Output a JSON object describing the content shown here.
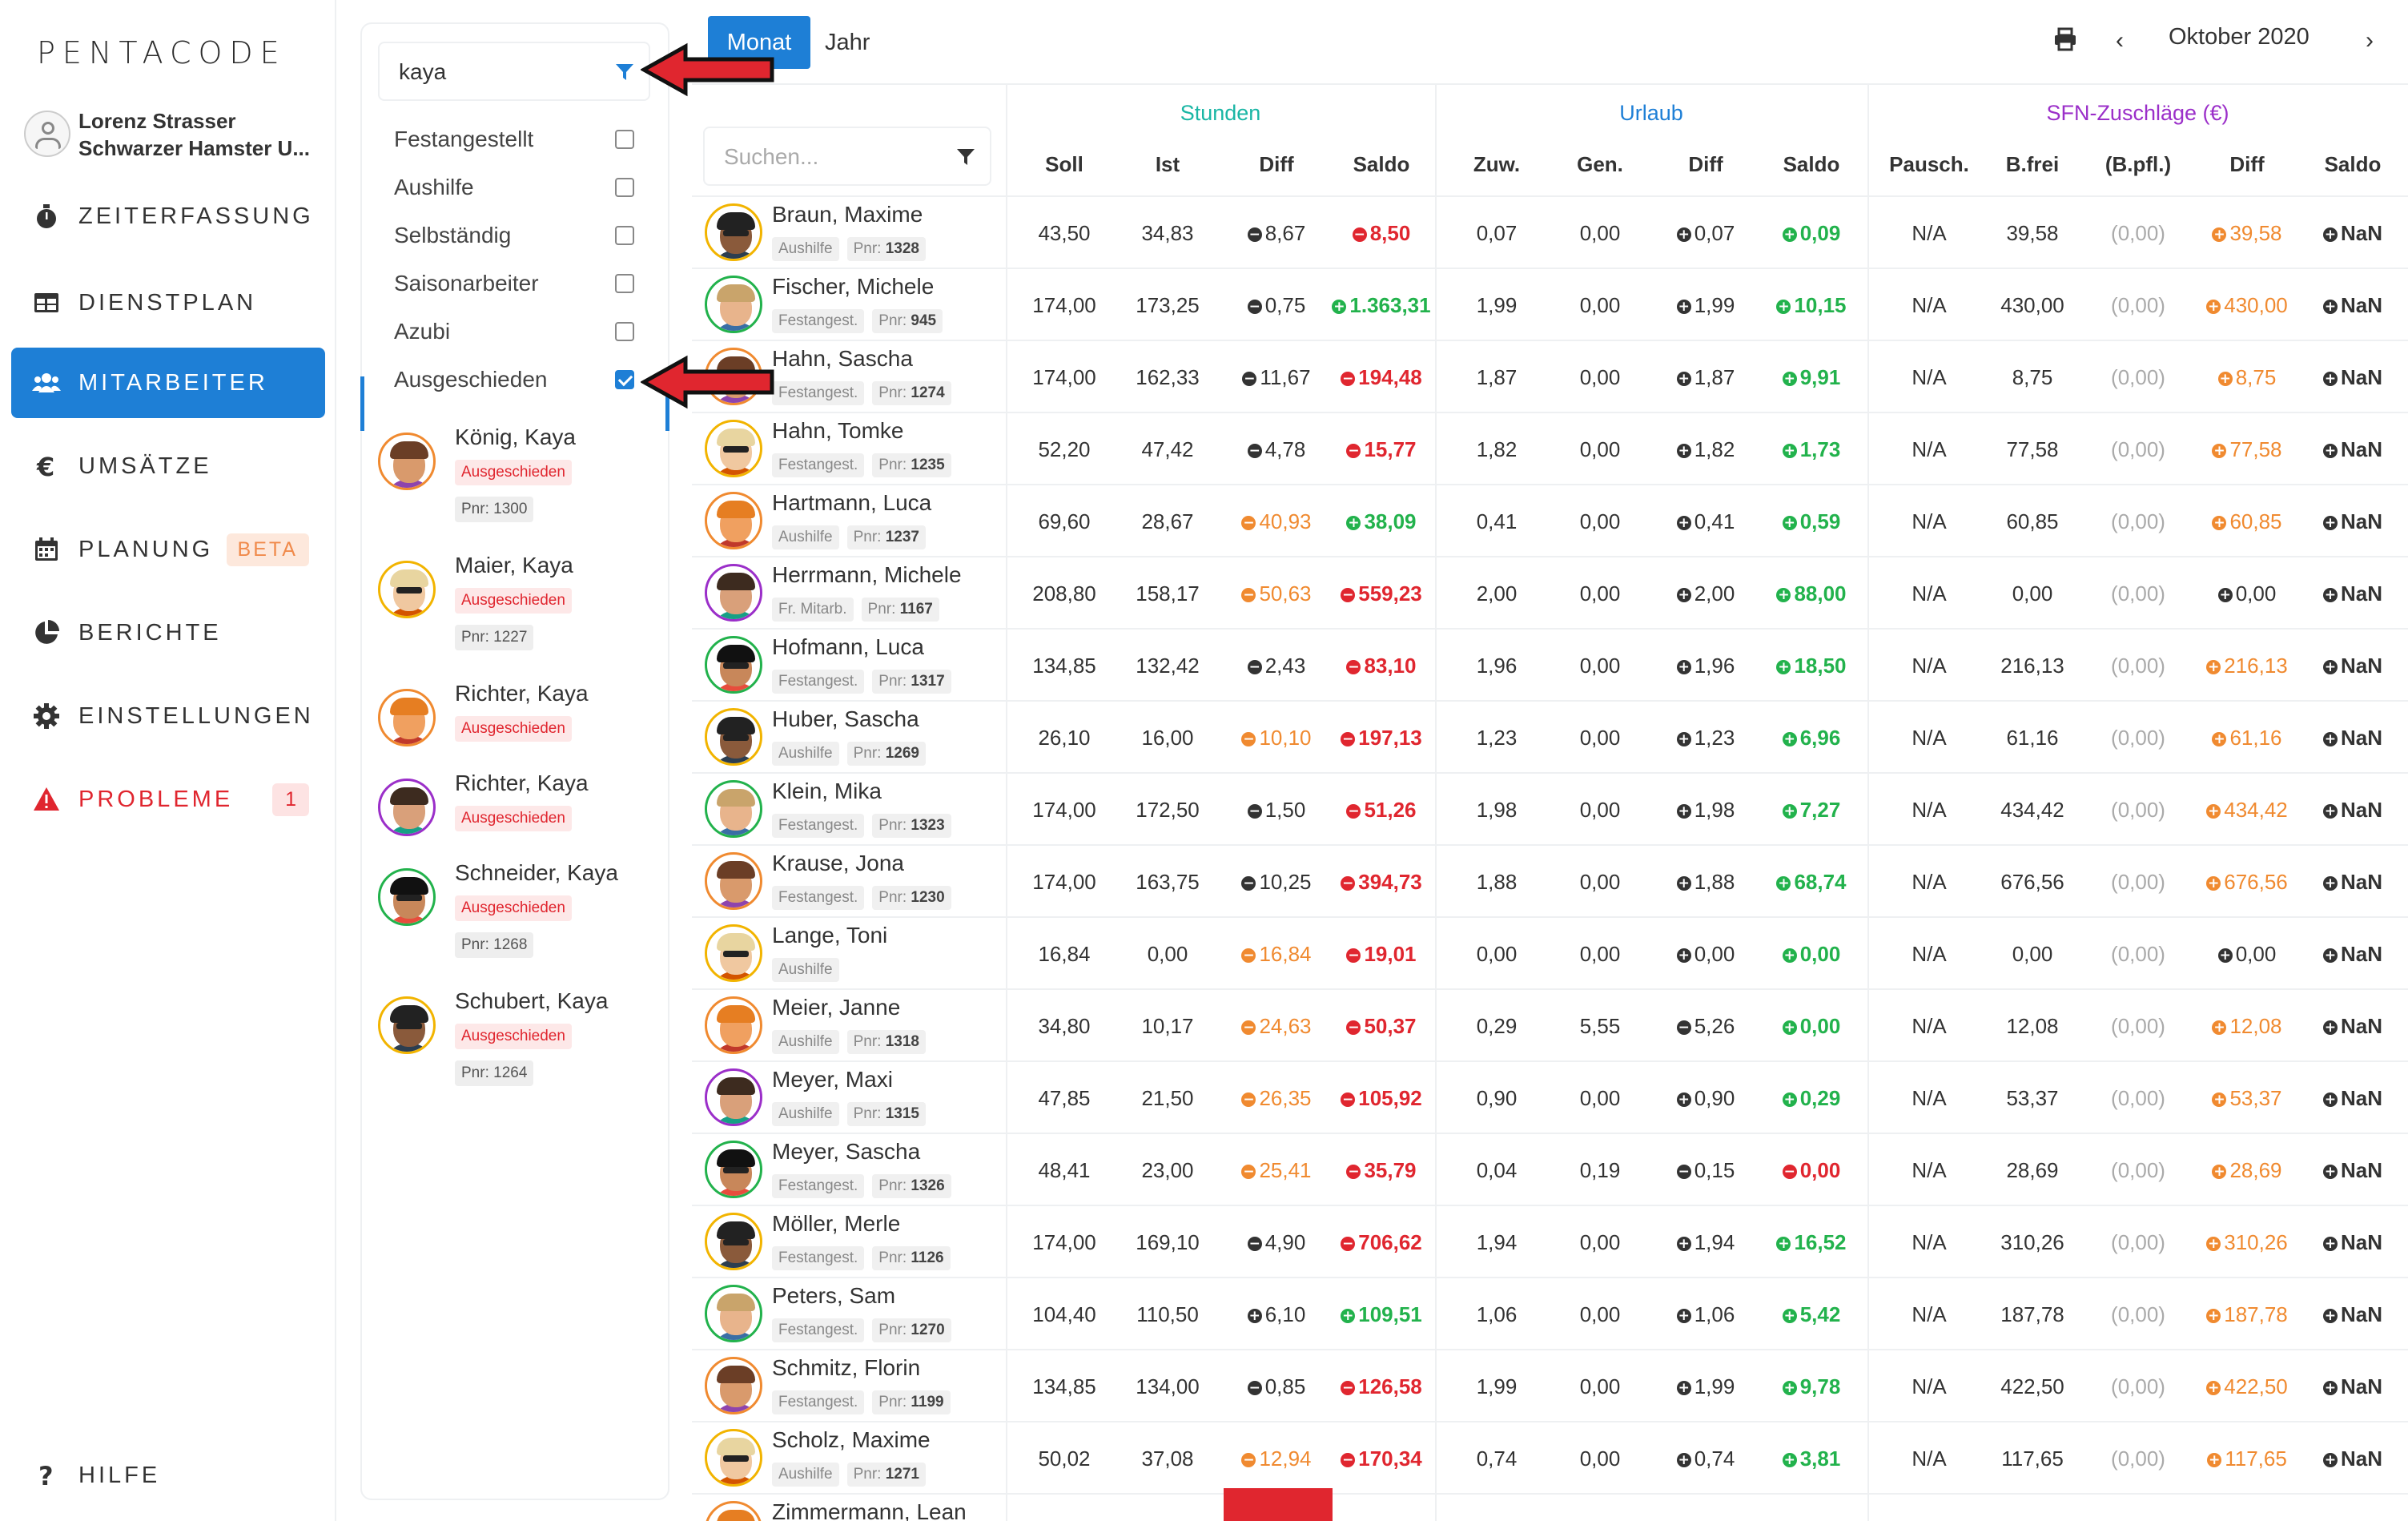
{
  "app": {
    "logo": "PENTACODE",
    "user_name": "Lorenz Strasser",
    "company": "Schwarzer Hamster U..."
  },
  "nav": [
    {
      "label": "ZEITERFASSUNG",
      "icon": "stopwatch-icon"
    },
    {
      "label": "DIENSTPLAN",
      "icon": "table-icon"
    },
    {
      "label": "MITARBEITER",
      "icon": "users-icon",
      "active": true
    },
    {
      "label": "UMSÄTZE",
      "icon": "euro-icon"
    },
    {
      "label": "PLANUNG",
      "icon": "calendar-icon",
      "badge": "BETA"
    },
    {
      "label": "BERICHTE",
      "icon": "pie-chart-icon"
    },
    {
      "label": "EINSTELLUNGEN",
      "icon": "gear-icon"
    },
    {
      "label": "PROBLEME",
      "icon": "warning-icon",
      "badge": "1"
    }
  ],
  "help": {
    "label": "HILFE",
    "icon": "question-icon"
  },
  "filter": {
    "search_value": "kaya",
    "options": [
      {
        "label": "Festangestellt",
        "checked": false
      },
      {
        "label": "Aushilfe",
        "checked": false
      },
      {
        "label": "Selbständig",
        "checked": false
      },
      {
        "label": "Saisonarbeiter",
        "checked": false
      },
      {
        "label": "Azubi",
        "checked": false
      },
      {
        "label": "Ausgeschieden",
        "checked": true
      }
    ],
    "results": [
      {
        "name": "König, Kaya",
        "status": "Ausgeschieden",
        "pnr": "Pnr: 1300"
      },
      {
        "name": "Maier, Kaya",
        "status": "Ausgeschieden",
        "pnr": "Pnr: 1227"
      },
      {
        "name": "Richter, Kaya",
        "status": "Ausgeschieden",
        "pnr": ""
      },
      {
        "name": "Richter, Kaya",
        "status": "Ausgeschieden",
        "pnr": ""
      },
      {
        "name": "Schneider, Kaya",
        "status": "Ausgeschieden",
        "pnr": "Pnr: 1268"
      },
      {
        "name": "Schubert, Kaya",
        "status": "Ausgeschieden",
        "pnr": "Pnr: 1264"
      }
    ]
  },
  "toolbar": {
    "tab_month": "Monat",
    "tab_year": "Jahr",
    "month_label": "Oktober 2020",
    "chev_left": "‹",
    "chev_right": "›"
  },
  "table": {
    "search_placeholder": "Suchen...",
    "groups": [
      {
        "label": "Stunden",
        "color": "#1ab6a5"
      },
      {
        "label": "Urlaub",
        "color": "#1e7fd6"
      },
      {
        "label": "SFN-Zuschläge (€)",
        "color": "#9b2fc9"
      }
    ],
    "columns": [
      "Soll",
      "Ist",
      "Diff",
      "Saldo",
      "Zuw.",
      "Gen.",
      "Diff",
      "Saldo",
      "Pausch.",
      "B.frei",
      "(B.pfl.)",
      "Diff",
      "Saldo"
    ],
    "rows": [
      {
        "name": "Braun, Maxime",
        "type": "Aushilfe",
        "pnr": "1328",
        "cells": [
          "43,50",
          "34,83",
          [
            "m",
            "8,67",
            "dark"
          ],
          [
            "m",
            "8,50",
            "red"
          ],
          "0,07",
          "0,00",
          [
            "p",
            "0,07",
            "dark"
          ],
          [
            "p",
            "0,09",
            "green"
          ],
          "N/A",
          "39,58",
          "(0,00)",
          [
            "p",
            "39,58",
            "orange"
          ],
          [
            "p",
            "NaN",
            "dark"
          ]
        ]
      },
      {
        "name": "Fischer, Michele",
        "type": "Festangest.",
        "pnr": "945",
        "cells": [
          "174,00",
          "173,25",
          [
            "m",
            "0,75",
            "dark"
          ],
          [
            "p",
            "1.363,31",
            "green"
          ],
          "1,99",
          "0,00",
          [
            "p",
            "1,99",
            "dark"
          ],
          [
            "p",
            "10,15",
            "green"
          ],
          "N/A",
          "430,00",
          "(0,00)",
          [
            "p",
            "430,00",
            "orange"
          ],
          [
            "p",
            "NaN",
            "dark"
          ]
        ]
      },
      {
        "name": "Hahn, Sascha",
        "type": "Festangest.",
        "pnr": "1274",
        "cells": [
          "174,00",
          "162,33",
          [
            "m",
            "11,67",
            "dark"
          ],
          [
            "m",
            "194,48",
            "red"
          ],
          "1,87",
          "0,00",
          [
            "p",
            "1,87",
            "dark"
          ],
          [
            "p",
            "9,91",
            "green"
          ],
          "N/A",
          "8,75",
          "(0,00)",
          [
            "p",
            "8,75",
            "orange"
          ],
          [
            "p",
            "NaN",
            "dark"
          ]
        ]
      },
      {
        "name": "Hahn, Tomke",
        "type": "Festangest.",
        "pnr": "1235",
        "cells": [
          "52,20",
          "47,42",
          [
            "m",
            "4,78",
            "dark"
          ],
          [
            "m",
            "15,77",
            "red"
          ],
          "1,82",
          "0,00",
          [
            "p",
            "1,82",
            "dark"
          ],
          [
            "p",
            "1,73",
            "green"
          ],
          "N/A",
          "77,58",
          "(0,00)",
          [
            "p",
            "77,58",
            "orange"
          ],
          [
            "p",
            "NaN",
            "dark"
          ]
        ]
      },
      {
        "name": "Hartmann, Luca",
        "type": "Aushilfe",
        "pnr": "1237",
        "cells": [
          "69,60",
          "28,67",
          [
            "m",
            "40,93",
            "orange"
          ],
          [
            "p",
            "38,09",
            "green"
          ],
          "0,41",
          "0,00",
          [
            "p",
            "0,41",
            "dark"
          ],
          [
            "p",
            "0,59",
            "green"
          ],
          "N/A",
          "60,85",
          "(0,00)",
          [
            "p",
            "60,85",
            "orange"
          ],
          [
            "p",
            "NaN",
            "dark"
          ]
        ]
      },
      {
        "name": "Herrmann, Michele",
        "type": "Fr. Mitarb.",
        "pnr": "1167",
        "cells": [
          "208,80",
          "158,17",
          [
            "m",
            "50,63",
            "orange"
          ],
          [
            "m",
            "559,23",
            "red"
          ],
          "2,00",
          "0,00",
          [
            "p",
            "2,00",
            "dark"
          ],
          [
            "p",
            "88,00",
            "green"
          ],
          "N/A",
          "0,00",
          "(0,00)",
          [
            "p",
            "0,00",
            "dark"
          ],
          [
            "p",
            "NaN",
            "dark"
          ]
        ]
      },
      {
        "name": "Hofmann, Luca",
        "type": "Festangest.",
        "pnr": "1317",
        "cells": [
          "134,85",
          "132,42",
          [
            "m",
            "2,43",
            "dark"
          ],
          [
            "m",
            "83,10",
            "red"
          ],
          "1,96",
          "0,00",
          [
            "p",
            "1,96",
            "dark"
          ],
          [
            "p",
            "18,50",
            "green"
          ],
          "N/A",
          "216,13",
          "(0,00)",
          [
            "p",
            "216,13",
            "orange"
          ],
          [
            "p",
            "NaN",
            "dark"
          ]
        ]
      },
      {
        "name": "Huber, Sascha",
        "type": "Aushilfe",
        "pnr": "1269",
        "cells": [
          "26,10",
          "16,00",
          [
            "m",
            "10,10",
            "orange"
          ],
          [
            "m",
            "197,13",
            "red"
          ],
          "1,23",
          "0,00",
          [
            "p",
            "1,23",
            "dark"
          ],
          [
            "p",
            "6,96",
            "green"
          ],
          "N/A",
          "61,16",
          "(0,00)",
          [
            "p",
            "61,16",
            "orange"
          ],
          [
            "p",
            "NaN",
            "dark"
          ]
        ]
      },
      {
        "name": "Klein, Mika",
        "type": "Festangest.",
        "pnr": "1323",
        "cells": [
          "174,00",
          "172,50",
          [
            "m",
            "1,50",
            "dark"
          ],
          [
            "m",
            "51,26",
            "red"
          ],
          "1,98",
          "0,00",
          [
            "p",
            "1,98",
            "dark"
          ],
          [
            "p",
            "7,27",
            "green"
          ],
          "N/A",
          "434,42",
          "(0,00)",
          [
            "p",
            "434,42",
            "orange"
          ],
          [
            "p",
            "NaN",
            "dark"
          ]
        ]
      },
      {
        "name": "Krause, Jona",
        "type": "Festangest.",
        "pnr": "1230",
        "cells": [
          "174,00",
          "163,75",
          [
            "m",
            "10,25",
            "dark"
          ],
          [
            "m",
            "394,73",
            "red"
          ],
          "1,88",
          "0,00",
          [
            "p",
            "1,88",
            "dark"
          ],
          [
            "p",
            "68,74",
            "green"
          ],
          "N/A",
          "676,56",
          "(0,00)",
          [
            "p",
            "676,56",
            "orange"
          ],
          [
            "p",
            "NaN",
            "dark"
          ]
        ]
      },
      {
        "name": "Lange, Toni",
        "type": "Aushilfe",
        "pnr": "",
        "cells": [
          "16,84",
          "0,00",
          [
            "m",
            "16,84",
            "orange"
          ],
          [
            "m",
            "19,01",
            "red"
          ],
          "0,00",
          "0,00",
          [
            "p",
            "0,00",
            "dark"
          ],
          [
            "p",
            "0,00",
            "green"
          ],
          "N/A",
          "0,00",
          "(0,00)",
          [
            "p",
            "0,00",
            "dark"
          ],
          [
            "p",
            "NaN",
            "dark"
          ]
        ]
      },
      {
        "name": "Meier, Janne",
        "type": "Aushilfe",
        "pnr": "1318",
        "cells": [
          "34,80",
          "10,17",
          [
            "m",
            "24,63",
            "orange"
          ],
          [
            "m",
            "50,37",
            "red"
          ],
          "0,29",
          "5,55",
          [
            "m",
            "5,26",
            "dark"
          ],
          [
            "p",
            "0,00",
            "green"
          ],
          "N/A",
          "12,08",
          "(0,00)",
          [
            "p",
            "12,08",
            "orange"
          ],
          [
            "p",
            "NaN",
            "dark"
          ]
        ]
      },
      {
        "name": "Meyer, Maxi",
        "type": "Aushilfe",
        "pnr": "1315",
        "cells": [
          "47,85",
          "21,50",
          [
            "m",
            "26,35",
            "orange"
          ],
          [
            "m",
            "105,92",
            "red"
          ],
          "0,90",
          "0,00",
          [
            "p",
            "0,90",
            "dark"
          ],
          [
            "p",
            "0,29",
            "green"
          ],
          "N/A",
          "53,37",
          "(0,00)",
          [
            "p",
            "53,37",
            "orange"
          ],
          [
            "p",
            "NaN",
            "dark"
          ]
        ]
      },
      {
        "name": "Meyer, Sascha",
        "type": "Festangest.",
        "pnr": "1326",
        "cells": [
          "48,41",
          "23,00",
          [
            "m",
            "25,41",
            "orange"
          ],
          [
            "m",
            "35,79",
            "red"
          ],
          "0,04",
          "0,19",
          [
            "m",
            "0,15",
            "dark"
          ],
          [
            "m",
            "0,00",
            "red"
          ],
          "N/A",
          "28,69",
          "(0,00)",
          [
            "p",
            "28,69",
            "orange"
          ],
          [
            "p",
            "NaN",
            "dark"
          ]
        ]
      },
      {
        "name": "Möller, Merle",
        "type": "Festangest.",
        "pnr": "1126",
        "cells": [
          "174,00",
          "169,10",
          [
            "m",
            "4,90",
            "dark"
          ],
          [
            "m",
            "706,62",
            "red"
          ],
          "1,94",
          "0,00",
          [
            "p",
            "1,94",
            "dark"
          ],
          [
            "p",
            "16,52",
            "green"
          ],
          "N/A",
          "310,26",
          "(0,00)",
          [
            "p",
            "310,26",
            "orange"
          ],
          [
            "p",
            "NaN",
            "dark"
          ]
        ]
      },
      {
        "name": "Peters, Sam",
        "type": "Festangest.",
        "pnr": "1270",
        "cells": [
          "104,40",
          "110,50",
          [
            "p",
            "6,10",
            "dark"
          ],
          [
            "p",
            "109,51",
            "green"
          ],
          "1,06",
          "0,00",
          [
            "p",
            "1,06",
            "dark"
          ],
          [
            "p",
            "5,42",
            "green"
          ],
          "N/A",
          "187,78",
          "(0,00)",
          [
            "p",
            "187,78",
            "orange"
          ],
          [
            "p",
            "NaN",
            "dark"
          ]
        ]
      },
      {
        "name": "Schmitz, Florin",
        "type": "Festangest.",
        "pnr": "1199",
        "cells": [
          "134,85",
          "134,00",
          [
            "m",
            "0,85",
            "dark"
          ],
          [
            "m",
            "126,58",
            "red"
          ],
          "1,99",
          "0,00",
          [
            "p",
            "1,99",
            "dark"
          ],
          [
            "p",
            "9,78",
            "green"
          ],
          "N/A",
          "422,50",
          "(0,00)",
          [
            "p",
            "422,50",
            "orange"
          ],
          [
            "p",
            "NaN",
            "dark"
          ]
        ]
      },
      {
        "name": "Scholz, Maxime",
        "type": "Aushilfe",
        "pnr": "1271",
        "cells": [
          "50,02",
          "37,08",
          [
            "m",
            "12,94",
            "orange"
          ],
          [
            "m",
            "170,34",
            "red"
          ],
          "0,74",
          "0,00",
          [
            "p",
            "0,74",
            "dark"
          ],
          [
            "p",
            "3,81",
            "green"
          ],
          "N/A",
          "117,65",
          "(0,00)",
          [
            "p",
            "117,65",
            "orange"
          ],
          [
            "p",
            "NaN",
            "dark"
          ]
        ]
      },
      {
        "name": "Zimmermann, Lean",
        "type": "",
        "pnr": "",
        "cells": []
      }
    ]
  }
}
